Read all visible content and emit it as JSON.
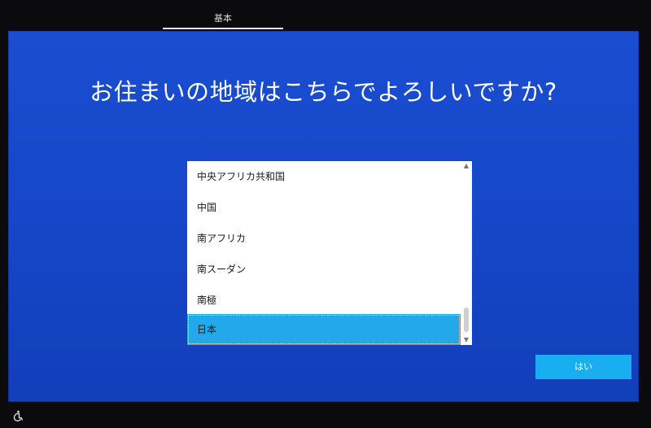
{
  "header": {
    "tab_label": "基本"
  },
  "main": {
    "question": "お住まいの地域はこちらでよろしいですか?",
    "regions": [
      "中央アフリカ共和国",
      "中国",
      "南アフリカ",
      "南スーダン",
      "南極",
      "日本"
    ],
    "selected_region": "日本",
    "yes_button_label": "はい"
  },
  "footer": {
    "accessibility_icon": "accessibility-icon"
  },
  "colors": {
    "background_blue": "#1547c8",
    "selection_blue": "#23a8ea",
    "button_blue": "#18aef0"
  }
}
